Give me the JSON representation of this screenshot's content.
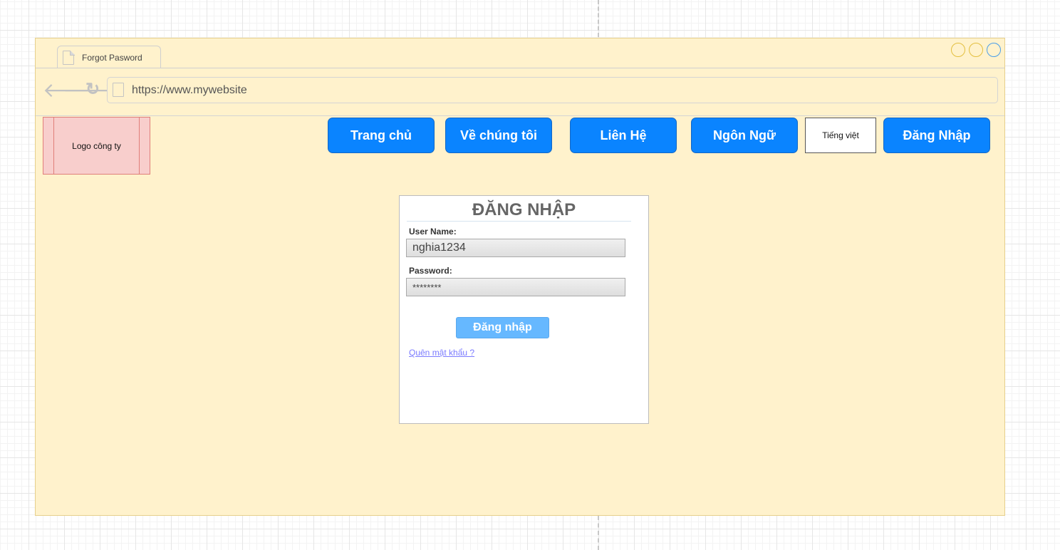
{
  "browser": {
    "tab_title": "Forgot Pasword",
    "url": "https://www.mywebsite"
  },
  "header": {
    "logo_text": "Logo công ty",
    "nav_items": [
      {
        "label": "Trang chủ"
      },
      {
        "label": "Về chúng tôi"
      },
      {
        "label": "Liên Hệ"
      },
      {
        "label": "Ngôn Ngữ"
      },
      {
        "label": "Đăng Nhập"
      }
    ],
    "language_value": "Tiếng việt"
  },
  "login": {
    "title": "ĐĂNG NHẬP",
    "username_label": "User Name:",
    "username_value": "nghia1234",
    "password_label": "Password:",
    "password_value": "********",
    "submit_label": "Đăng nhập",
    "forgot_link": "Quên mật khẩu ?"
  },
  "colors": {
    "window_bg": "#fff2cc",
    "nav_button": "#0a84ff",
    "logo_bg": "#f8cecc",
    "submit_button": "#66b8ff"
  }
}
